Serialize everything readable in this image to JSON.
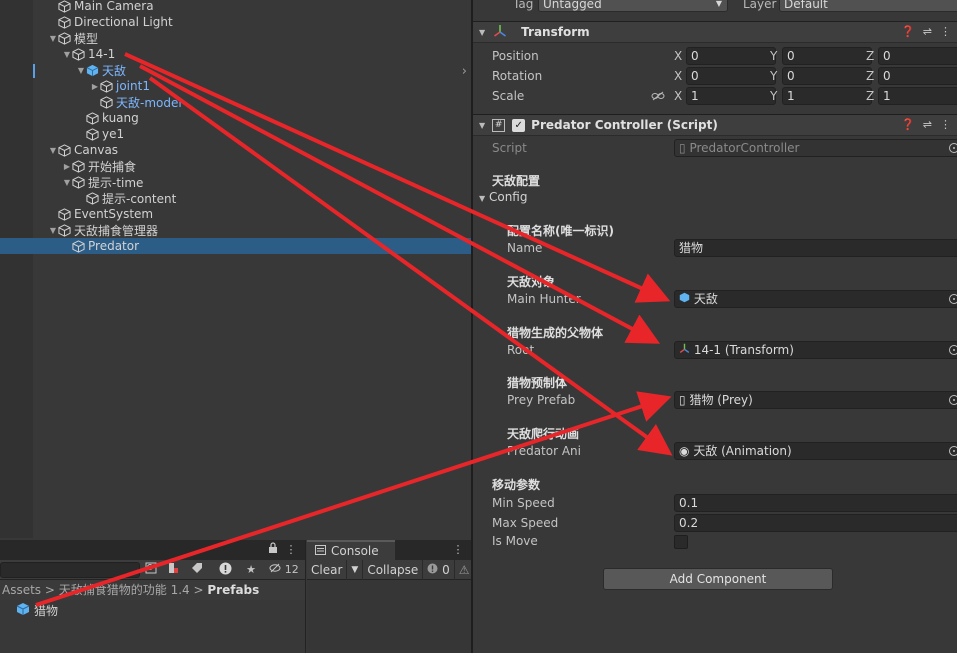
{
  "hierarchy": {
    "items": [
      {
        "label": "Main Camera",
        "depth": 0,
        "fold": "none",
        "kind": "obj"
      },
      {
        "label": "Directional Light",
        "depth": 0,
        "fold": "none",
        "kind": "obj"
      },
      {
        "label": "模型",
        "depth": 0,
        "fold": "open",
        "kind": "obj"
      },
      {
        "label": "14-1",
        "depth": 1,
        "fold": "open",
        "kind": "obj"
      },
      {
        "label": "天敌",
        "depth": 2,
        "fold": "open",
        "kind": "prefab"
      },
      {
        "label": "joint1",
        "depth": 3,
        "fold": "closed",
        "kind": "prefab"
      },
      {
        "label": "天敌-model",
        "depth": 3,
        "fold": "none",
        "kind": "prefab"
      },
      {
        "label": "kuang",
        "depth": 2,
        "fold": "none",
        "kind": "obj"
      },
      {
        "label": "ye1",
        "depth": 2,
        "fold": "none",
        "kind": "obj"
      },
      {
        "label": "Canvas",
        "depth": 0,
        "fold": "open",
        "kind": "obj"
      },
      {
        "label": "开始捕食",
        "depth": 1,
        "fold": "closed",
        "kind": "obj"
      },
      {
        "label": "提示-time",
        "depth": 1,
        "fold": "open",
        "kind": "obj"
      },
      {
        "label": "提示-content",
        "depth": 2,
        "fold": "none",
        "kind": "obj"
      },
      {
        "label": "EventSystem",
        "depth": 0,
        "fold": "none",
        "kind": "obj"
      },
      {
        "label": "天敌捕食管理器",
        "depth": 0,
        "fold": "open",
        "kind": "obj"
      },
      {
        "label": "Predator",
        "depth": 1,
        "fold": "none",
        "kind": "obj",
        "selected": true
      }
    ]
  },
  "project": {
    "hidden_count": "12",
    "breadcrumb": {
      "assets": "Assets",
      "folder": "天敌捕食猎物的功能 1.4",
      "last": "Prefabs"
    },
    "asset_label": "猎物"
  },
  "console": {
    "tab_label": "Console",
    "clear": "Clear",
    "collapse": "Collapse",
    "error_count": "0"
  },
  "inspector": {
    "tag_label": "Tag",
    "tag_value": "Untagged",
    "layer_label": "Layer",
    "layer_value": "Default",
    "transform": {
      "title": "Transform",
      "position_label": "Position",
      "rotation_label": "Rotation",
      "scale_label": "Scale",
      "position": {
        "x": "0",
        "y": "0",
        "z": "0"
      },
      "rotation": {
        "x": "0",
        "y": "0",
        "z": "0"
      },
      "scale": {
        "x": "1",
        "y": "1",
        "z": "1"
      }
    },
    "script_comp": {
      "title": "Predator Controller (Script)",
      "script_label": "Script",
      "script_value": "PredatorController",
      "section_enemy": "天敌配置",
      "config_label": "Config",
      "name_header": "配置名称(唯一标识)",
      "name_label": "Name",
      "name_value": "猎物",
      "hunter_header": "天敌对象",
      "hunter_label": "Main Hunter",
      "hunter_value": "天敌",
      "root_header": "猎物生成的父物体",
      "root_label": "Root",
      "root_value": "14-1 (Transform)",
      "prey_header": "猎物预制体",
      "prey_label": "Prey Prefab",
      "prey_value": "猎物 (Prey)",
      "ani_header": "天敌爬行动画",
      "ani_label": "Predator Ani",
      "ani_value": "天敌 (Animation)",
      "move_header": "移动参数",
      "min_label": "Min Speed",
      "min_value": "0.1",
      "max_label": "Max Speed",
      "max_value": "0.2",
      "ismove_label": "Is Move"
    },
    "add_component": "Add Component"
  },
  "colors": {
    "annotation_arrow": "#e8262a",
    "selection": "#2c5d87",
    "prefab_text": "#7cb6ff"
  }
}
